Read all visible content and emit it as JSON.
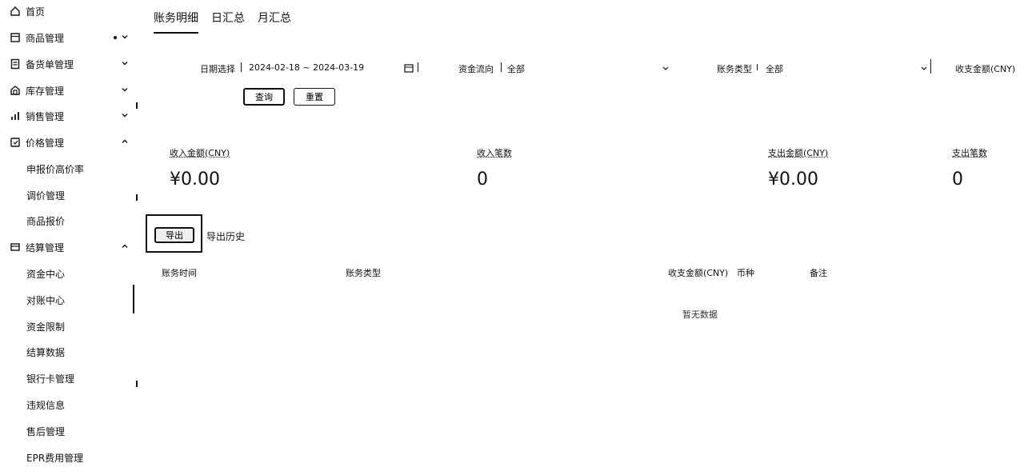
{
  "sidebar": {
    "items": [
      {
        "label": "首页",
        "icon": "home-icon",
        "expandable": false
      },
      {
        "label": "商品管理",
        "icon": "product-icon",
        "expandable": true,
        "expanded": false,
        "has_dot": true
      },
      {
        "label": "备货单管理",
        "icon": "order-icon",
        "expandable": true,
        "expanded": false
      },
      {
        "label": "库存管理",
        "icon": "inventory-icon",
        "expandable": true,
        "expanded": false
      },
      {
        "label": "销售管理",
        "icon": "sales-chart-icon",
        "expandable": true,
        "expanded": false
      },
      {
        "label": "价格管理",
        "icon": "price-tag-icon",
        "expandable": true,
        "expanded": true,
        "children": [
          "申报价高价率",
          "调价管理",
          "商品报价"
        ]
      },
      {
        "label": "结算管理",
        "icon": "settlement-icon",
        "expandable": true,
        "expanded": true,
        "children": [
          "资金中心",
          "对账中心",
          "资金限制",
          "结算数据",
          "银行卡管理",
          "违规信息",
          "售后管理",
          "EPR费用管理"
        ]
      }
    ]
  },
  "tabs": [
    {
      "label": "账务明细",
      "active": true
    },
    {
      "label": "日汇总",
      "active": false
    },
    {
      "label": "月汇总",
      "active": false
    }
  ],
  "filters": {
    "date_label": "日期选择",
    "date_range": "2024-02-18 ~ 2024-03-19",
    "fund_flow_label": "资金流向",
    "fund_flow_value": "全部",
    "type_label": "账务类型",
    "type_value": "全部",
    "amount_label": "收支金额(CNY)",
    "search_button": "查询",
    "reset_button": "重置"
  },
  "stats": [
    {
      "label": "收入金额(CNY)",
      "value": "¥0.00"
    },
    {
      "label": "收入笔数",
      "value": "0"
    },
    {
      "label": "支出金额(CNY)",
      "value": "¥0.00"
    },
    {
      "label": "支出笔数",
      "value": "0"
    }
  ],
  "export": {
    "button": "导出",
    "history_link": "导出历史"
  },
  "table": {
    "columns": [
      "账务时间",
      "账务类型",
      "收支金额(CNY)",
      "币种",
      "备注"
    ],
    "rows": [],
    "empty_text": "暂无数据"
  }
}
